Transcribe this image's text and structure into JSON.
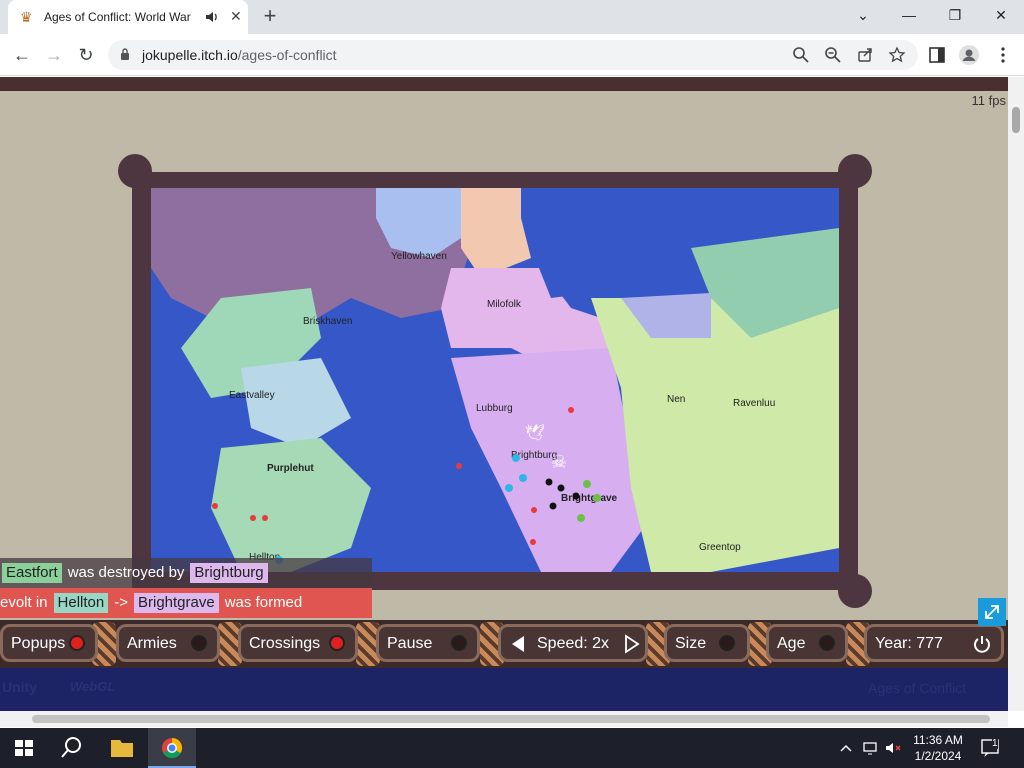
{
  "browser": {
    "tab_title": "Ages of Conflict: World War",
    "url_host": "jokupelle.itch.io",
    "url_path": "/ages-of-conflict",
    "icons": [
      "crown-icon",
      "speaker-icon",
      "close-icon",
      "plus-icon",
      "chevron-down-icon",
      "minimize-icon",
      "restore-icon",
      "window-close-icon",
      "back-icon",
      "forward-icon",
      "reload-icon",
      "lock-icon",
      "search-icon",
      "zoom-out-icon",
      "share-icon",
      "star-icon",
      "sidebar-icon",
      "profile-icon",
      "kebab-menu-icon"
    ]
  },
  "game": {
    "fps": "11 fps",
    "cities": [
      "Yellowhaven",
      "Briskhaven",
      "Milofolk",
      "Eastvalley",
      "Lubburg",
      "Nen",
      "Ravenluu",
      "Purplehut",
      "Brightburg",
      "Brightgrave",
      "Greentop",
      "Hellton"
    ],
    "news": [
      {
        "name": "Eastfort",
        "mid": "was destroyed by",
        "by": "Brightburg"
      },
      {
        "prefix": "evolt in",
        "name": "Hellton",
        "arrow": "->",
        "by": "Brightgrave",
        "suffix": "was formed"
      }
    ],
    "controls": {
      "popups": "Popups",
      "popups_on": true,
      "armies": "Armies",
      "armies_on": false,
      "crossings": "Crossings",
      "crossings_on": true,
      "pause": "Pause",
      "pause_on": false,
      "speed": "Speed: 2x",
      "size": "Size",
      "size_on": false,
      "age": "Age",
      "age_on": false,
      "year": "Year: 777"
    },
    "footer": {
      "unity": "Unity",
      "webgl": "WebGL",
      "title": "Ages of Conflict"
    }
  },
  "taskbar": {
    "time": "11:36 AM",
    "date": "1/2/2024",
    "notification_count": "1",
    "icons": [
      "windows-start-icon",
      "search-icon",
      "file-explorer-icon",
      "chrome-icon",
      "chevron-up-icon",
      "network-icon",
      "volume-muted-icon",
      "notification-icon"
    ]
  },
  "colors": {
    "frame": "#4e3640",
    "sea": "#3657c8",
    "news_red": "#e0554f",
    "taskbar": "#1d1f2a"
  }
}
